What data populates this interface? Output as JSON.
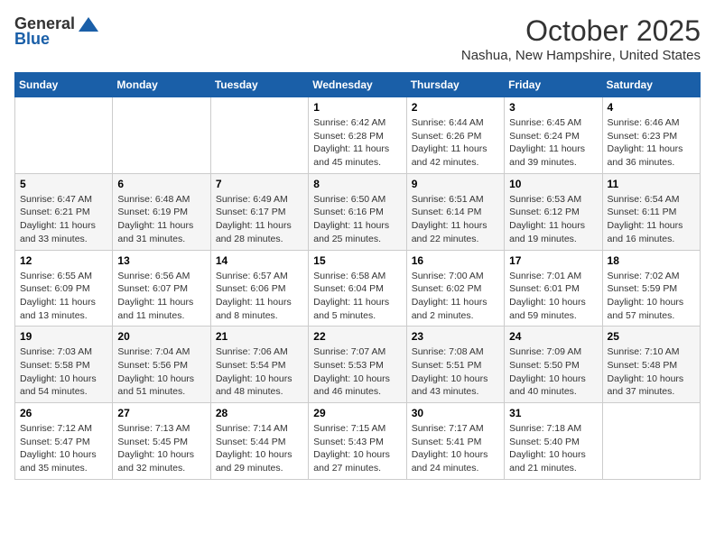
{
  "header": {
    "logo_general": "General",
    "logo_blue": "Blue",
    "month": "October 2025",
    "location": "Nashua, New Hampshire, United States"
  },
  "days_of_week": [
    "Sunday",
    "Monday",
    "Tuesday",
    "Wednesday",
    "Thursday",
    "Friday",
    "Saturday"
  ],
  "weeks": [
    [
      {
        "num": "",
        "sunrise": "",
        "sunset": "",
        "daylight": ""
      },
      {
        "num": "",
        "sunrise": "",
        "sunset": "",
        "daylight": ""
      },
      {
        "num": "",
        "sunrise": "",
        "sunset": "",
        "daylight": ""
      },
      {
        "num": "1",
        "sunrise": "Sunrise: 6:42 AM",
        "sunset": "Sunset: 6:28 PM",
        "daylight": "Daylight: 11 hours and 45 minutes."
      },
      {
        "num": "2",
        "sunrise": "Sunrise: 6:44 AM",
        "sunset": "Sunset: 6:26 PM",
        "daylight": "Daylight: 11 hours and 42 minutes."
      },
      {
        "num": "3",
        "sunrise": "Sunrise: 6:45 AM",
        "sunset": "Sunset: 6:24 PM",
        "daylight": "Daylight: 11 hours and 39 minutes."
      },
      {
        "num": "4",
        "sunrise": "Sunrise: 6:46 AM",
        "sunset": "Sunset: 6:23 PM",
        "daylight": "Daylight: 11 hours and 36 minutes."
      }
    ],
    [
      {
        "num": "5",
        "sunrise": "Sunrise: 6:47 AM",
        "sunset": "Sunset: 6:21 PM",
        "daylight": "Daylight: 11 hours and 33 minutes."
      },
      {
        "num": "6",
        "sunrise": "Sunrise: 6:48 AM",
        "sunset": "Sunset: 6:19 PM",
        "daylight": "Daylight: 11 hours and 31 minutes."
      },
      {
        "num": "7",
        "sunrise": "Sunrise: 6:49 AM",
        "sunset": "Sunset: 6:17 PM",
        "daylight": "Daylight: 11 hours and 28 minutes."
      },
      {
        "num": "8",
        "sunrise": "Sunrise: 6:50 AM",
        "sunset": "Sunset: 6:16 PM",
        "daylight": "Daylight: 11 hours and 25 minutes."
      },
      {
        "num": "9",
        "sunrise": "Sunrise: 6:51 AM",
        "sunset": "Sunset: 6:14 PM",
        "daylight": "Daylight: 11 hours and 22 minutes."
      },
      {
        "num": "10",
        "sunrise": "Sunrise: 6:53 AM",
        "sunset": "Sunset: 6:12 PM",
        "daylight": "Daylight: 11 hours and 19 minutes."
      },
      {
        "num": "11",
        "sunrise": "Sunrise: 6:54 AM",
        "sunset": "Sunset: 6:11 PM",
        "daylight": "Daylight: 11 hours and 16 minutes."
      }
    ],
    [
      {
        "num": "12",
        "sunrise": "Sunrise: 6:55 AM",
        "sunset": "Sunset: 6:09 PM",
        "daylight": "Daylight: 11 hours and 13 minutes."
      },
      {
        "num": "13",
        "sunrise": "Sunrise: 6:56 AM",
        "sunset": "Sunset: 6:07 PM",
        "daylight": "Daylight: 11 hours and 11 minutes."
      },
      {
        "num": "14",
        "sunrise": "Sunrise: 6:57 AM",
        "sunset": "Sunset: 6:06 PM",
        "daylight": "Daylight: 11 hours and 8 minutes."
      },
      {
        "num": "15",
        "sunrise": "Sunrise: 6:58 AM",
        "sunset": "Sunset: 6:04 PM",
        "daylight": "Daylight: 11 hours and 5 minutes."
      },
      {
        "num": "16",
        "sunrise": "Sunrise: 7:00 AM",
        "sunset": "Sunset: 6:02 PM",
        "daylight": "Daylight: 11 hours and 2 minutes."
      },
      {
        "num": "17",
        "sunrise": "Sunrise: 7:01 AM",
        "sunset": "Sunset: 6:01 PM",
        "daylight": "Daylight: 10 hours and 59 minutes."
      },
      {
        "num": "18",
        "sunrise": "Sunrise: 7:02 AM",
        "sunset": "Sunset: 5:59 PM",
        "daylight": "Daylight: 10 hours and 57 minutes."
      }
    ],
    [
      {
        "num": "19",
        "sunrise": "Sunrise: 7:03 AM",
        "sunset": "Sunset: 5:58 PM",
        "daylight": "Daylight: 10 hours and 54 minutes."
      },
      {
        "num": "20",
        "sunrise": "Sunrise: 7:04 AM",
        "sunset": "Sunset: 5:56 PM",
        "daylight": "Daylight: 10 hours and 51 minutes."
      },
      {
        "num": "21",
        "sunrise": "Sunrise: 7:06 AM",
        "sunset": "Sunset: 5:54 PM",
        "daylight": "Daylight: 10 hours and 48 minutes."
      },
      {
        "num": "22",
        "sunrise": "Sunrise: 7:07 AM",
        "sunset": "Sunset: 5:53 PM",
        "daylight": "Daylight: 10 hours and 46 minutes."
      },
      {
        "num": "23",
        "sunrise": "Sunrise: 7:08 AM",
        "sunset": "Sunset: 5:51 PM",
        "daylight": "Daylight: 10 hours and 43 minutes."
      },
      {
        "num": "24",
        "sunrise": "Sunrise: 7:09 AM",
        "sunset": "Sunset: 5:50 PM",
        "daylight": "Daylight: 10 hours and 40 minutes."
      },
      {
        "num": "25",
        "sunrise": "Sunrise: 7:10 AM",
        "sunset": "Sunset: 5:48 PM",
        "daylight": "Daylight: 10 hours and 37 minutes."
      }
    ],
    [
      {
        "num": "26",
        "sunrise": "Sunrise: 7:12 AM",
        "sunset": "Sunset: 5:47 PM",
        "daylight": "Daylight: 10 hours and 35 minutes."
      },
      {
        "num": "27",
        "sunrise": "Sunrise: 7:13 AM",
        "sunset": "Sunset: 5:45 PM",
        "daylight": "Daylight: 10 hours and 32 minutes."
      },
      {
        "num": "28",
        "sunrise": "Sunrise: 7:14 AM",
        "sunset": "Sunset: 5:44 PM",
        "daylight": "Daylight: 10 hours and 29 minutes."
      },
      {
        "num": "29",
        "sunrise": "Sunrise: 7:15 AM",
        "sunset": "Sunset: 5:43 PM",
        "daylight": "Daylight: 10 hours and 27 minutes."
      },
      {
        "num": "30",
        "sunrise": "Sunrise: 7:17 AM",
        "sunset": "Sunset: 5:41 PM",
        "daylight": "Daylight: 10 hours and 24 minutes."
      },
      {
        "num": "31",
        "sunrise": "Sunrise: 7:18 AM",
        "sunset": "Sunset: 5:40 PM",
        "daylight": "Daylight: 10 hours and 21 minutes."
      },
      {
        "num": "",
        "sunrise": "",
        "sunset": "",
        "daylight": ""
      }
    ]
  ]
}
